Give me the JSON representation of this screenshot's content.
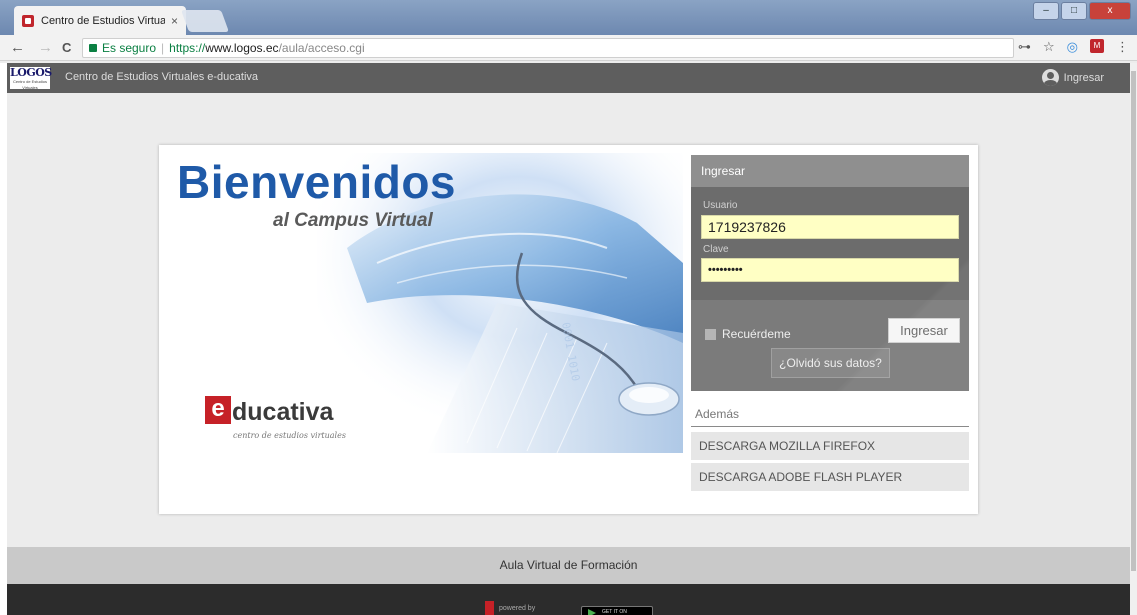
{
  "browser": {
    "tab_title": "Centro de Estudios Virtua",
    "tab_close": "×",
    "secure_label": "Es seguro",
    "url_scheme": "https://",
    "url_host": "www.logos.ec",
    "url_path": "/aula/acceso.cgi",
    "back": "←",
    "forward": "→",
    "reload": "C",
    "key_icon": "⊶",
    "star_icon": "☆",
    "ext1_icon": "◎",
    "ext2_icon": "M",
    "menu_icon": "⋮",
    "win_min": "–",
    "win_max": "□",
    "win_close": "x"
  },
  "header": {
    "logo_text": "LOGOS",
    "logo_sub": "Centro de Estudios Virtuales",
    "site_title": "Centro de Estudios Virtuales e-ducativa",
    "login_link": "Ingresar"
  },
  "hero": {
    "title": "Bienvenidos",
    "subtitle": "al Campus Virtual",
    "brand_e": "e",
    "brand_rest": "ducativa",
    "brand_sub": "centro de estudios virtuales"
  },
  "login": {
    "heading": "Ingresar",
    "user_label": "Usuario",
    "user_value": "1719237826",
    "pass_label": "Clave",
    "pass_value": "•••••••••",
    "remember_label": "Recuérdeme",
    "submit_label": "Ingresar",
    "forgot_label": "¿Olvidó sus datos?"
  },
  "extras": {
    "heading": "Además",
    "items": [
      "DESCARGA MOZILLA FIREFOX",
      "DESCARGA ADOBE FLASH PLAYER"
    ]
  },
  "footer": {
    "title": "Aula Virtual de Formación",
    "powered": "powered by",
    "gplay": "GET IT ON"
  },
  "colors": {
    "accent_blue": "#1f5aa8",
    "brand_red": "#c62127",
    "input_yellow": "#ffffc4",
    "header_gray": "#5e5e5e"
  }
}
